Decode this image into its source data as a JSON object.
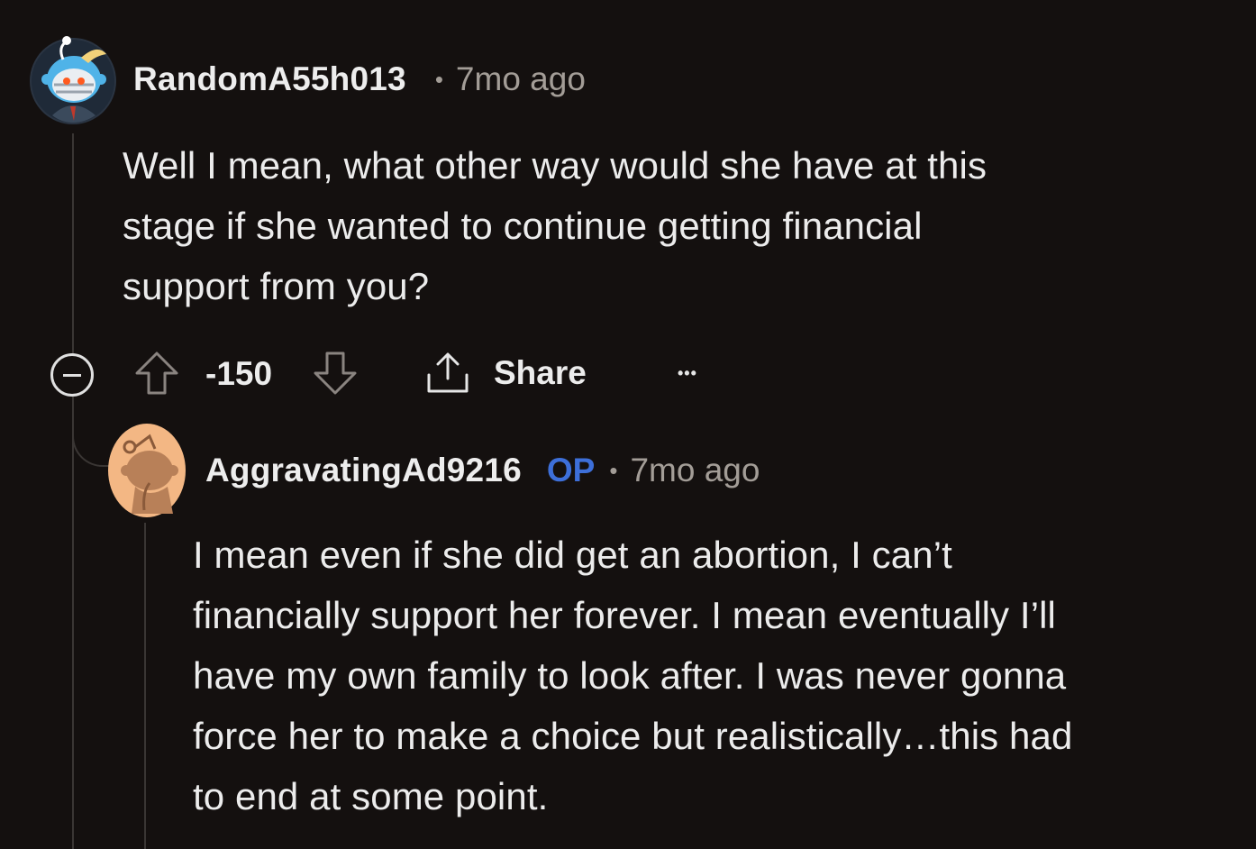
{
  "comment1": {
    "username": "RandomA55h013",
    "separator": "•",
    "time": "7mo ago",
    "body_lines": [
      "Well I mean, what other way would she have at this",
      "stage if she wanted to continue getting financial",
      "support from you?"
    ],
    "actions": {
      "score": "-150",
      "share_label": "Share",
      "more_label": "•••"
    }
  },
  "comment2": {
    "username": "AggravatingAd9216",
    "op_badge": "OP",
    "separator": "•",
    "time": "7mo ago",
    "body_lines": [
      "I mean even if she did get an abortion, I can’t",
      "financially support her forever. I mean eventually I’ll",
      "have my own family to look after. I was never gonna",
      "force her to make a choice but realistically…this had",
      "to end at some point."
    ]
  },
  "colors": {
    "background": "#14100f",
    "text": "#ececec",
    "muted": "#a39d97",
    "op_blue": "#3d6fd9",
    "thread_line": "#3a3634"
  }
}
